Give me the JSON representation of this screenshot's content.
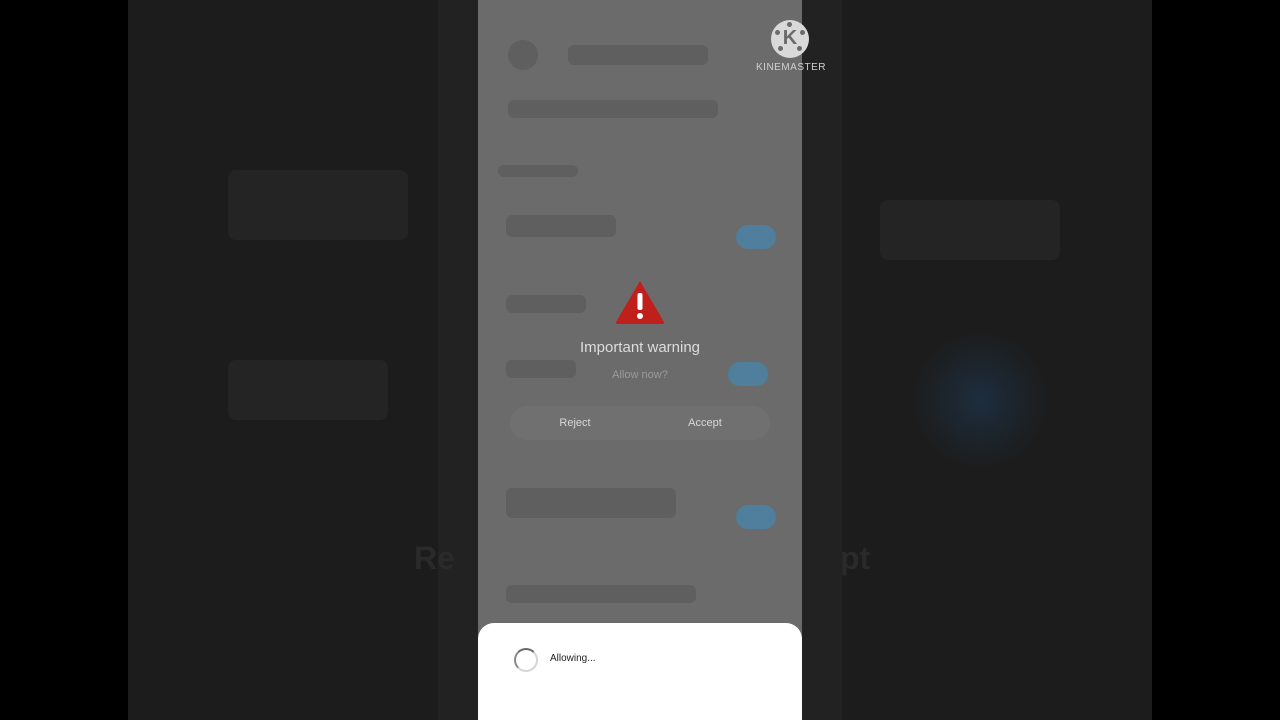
{
  "watermark": {
    "letter": "K",
    "text": "KINEMASTER"
  },
  "dialog": {
    "icon": "warning-triangle-icon",
    "icon_color": "#c0201b",
    "title": "Important warning",
    "subtitle": "Allow now?",
    "reject_label": "Reject",
    "accept_label": "Accept"
  },
  "background": {
    "left_text": "Re",
    "right_text": "pt"
  },
  "progress_sheet": {
    "icon": "loading-spinner-icon",
    "status": "Allowing..."
  }
}
